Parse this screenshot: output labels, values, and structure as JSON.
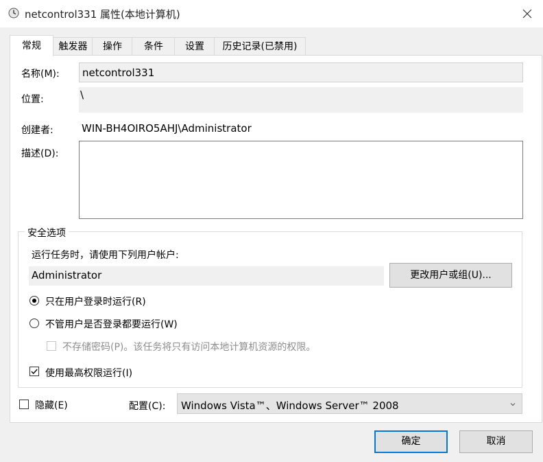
{
  "window": {
    "title": "netcontrol331 属性(本地计算机)"
  },
  "tabs": [
    {
      "label": "常规",
      "active": true
    },
    {
      "label": "触发器"
    },
    {
      "label": "操作"
    },
    {
      "label": "条件"
    },
    {
      "label": "设置"
    },
    {
      "label": "历史记录(已禁用)"
    }
  ],
  "general": {
    "name_label": "名称(M):",
    "name_value": "netcontrol331",
    "location_label": "位置:",
    "location_value": "\\",
    "author_label": "创建者:",
    "author_value": "WIN-BH4OIRO5AHJ\\Administrator",
    "description_label": "描述(D):",
    "description_value": ""
  },
  "security": {
    "group_title": "安全选项",
    "run_as_prompt": "运行任务时，请使用下列用户帐户:",
    "user_account": "Administrator",
    "change_user_button": "更改用户或组(U)...",
    "radio_logged_on": "只在用户登录时运行(R)",
    "radio_logged_on_checked": true,
    "radio_whether_logged": "不管用户是否登录都要运行(W)",
    "no_store_password": "不存储密码(P)。该任务将只有访问本地计算机资源的权限。",
    "highest_privileges": "使用最高权限运行(I)",
    "highest_privileges_checked": true
  },
  "bottom": {
    "hidden_label": "隐藏(E)",
    "configure_label": "配置(C):",
    "configure_value": "Windows Vista™、Windows Server™ 2008"
  },
  "buttons": {
    "ok": "确定",
    "cancel": "取消"
  },
  "colors": {
    "accent": "#0078d7",
    "window_bg": "#f0f0f0",
    "panel_bg": "#ffffff"
  }
}
